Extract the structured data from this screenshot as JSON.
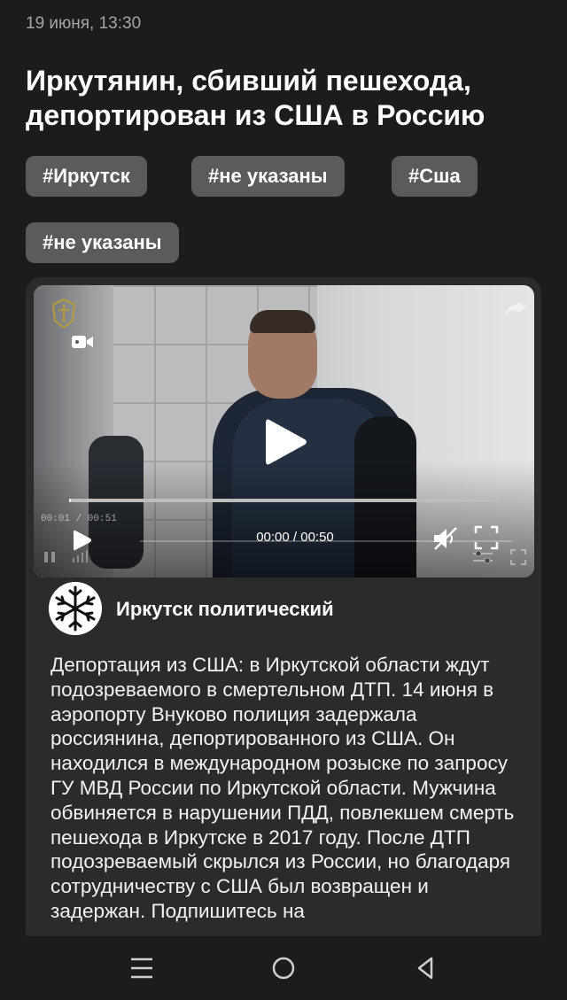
{
  "article": {
    "date": "19 июня, 13:30",
    "title": "Иркутянин, сбивший пешехода, депортирован из США в Россию",
    "tags": [
      "#Иркутск",
      "#не указаны",
      "#Сша",
      "#не указаны"
    ]
  },
  "video": {
    "time_display": "00:00 / 00:50",
    "ghost_time": "00:01 / 00:51",
    "progress_percent": 0.5
  },
  "post": {
    "channel_name": "Иркутск политический",
    "text": "Депортация из США: в Иркутской области ждут подозреваемого в смертельном ДТП. 14 июня в аэропорту Внуково полиция задержала россиянина, депортированного из США. Он находился в международном розыске по запросу ГУ МВД России по Иркутской области. Мужчина обвиняется в нарушении ПДД, повлекшем смерть пешехода в Иркутске в 2017 году. После ДТП подозреваемый скрылся из России, но благодаря сотрудничеству с США был возвращен и задержан. Подпишитесь на"
  },
  "icons": {
    "video_camera": "video-camera-icon",
    "share": "share-icon",
    "play": "play-icon",
    "mute": "volume-muted-icon",
    "fullscreen": "fullscreen-icon",
    "nav_recents": "recents-icon",
    "nav_home": "home-icon",
    "nav_back": "back-icon"
  },
  "colors": {
    "background": "#1c1c1c",
    "card": "#2b2b2b",
    "tag": "#5b5b5b",
    "date": "#a5a5a5"
  }
}
